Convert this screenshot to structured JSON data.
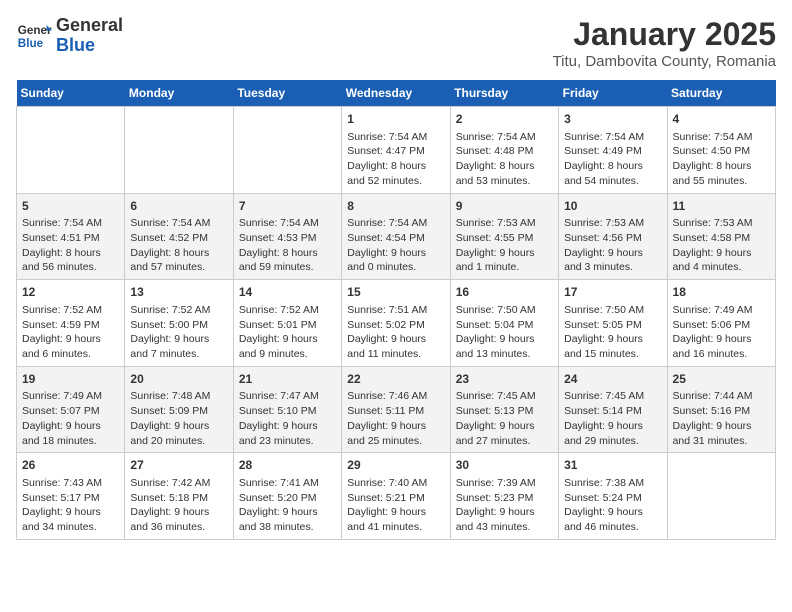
{
  "header": {
    "logo_general": "General",
    "logo_blue": "Blue",
    "title": "January 2025",
    "subtitle": "Titu, Dambovita County, Romania"
  },
  "days_of_week": [
    "Sunday",
    "Monday",
    "Tuesday",
    "Wednesday",
    "Thursday",
    "Friday",
    "Saturday"
  ],
  "weeks": [
    [
      {
        "day": "",
        "detail": ""
      },
      {
        "day": "",
        "detail": ""
      },
      {
        "day": "",
        "detail": ""
      },
      {
        "day": "1",
        "detail": "Sunrise: 7:54 AM\nSunset: 4:47 PM\nDaylight: 8 hours and 52 minutes."
      },
      {
        "day": "2",
        "detail": "Sunrise: 7:54 AM\nSunset: 4:48 PM\nDaylight: 8 hours and 53 minutes."
      },
      {
        "day": "3",
        "detail": "Sunrise: 7:54 AM\nSunset: 4:49 PM\nDaylight: 8 hours and 54 minutes."
      },
      {
        "day": "4",
        "detail": "Sunrise: 7:54 AM\nSunset: 4:50 PM\nDaylight: 8 hours and 55 minutes."
      }
    ],
    [
      {
        "day": "5",
        "detail": "Sunrise: 7:54 AM\nSunset: 4:51 PM\nDaylight: 8 hours and 56 minutes."
      },
      {
        "day": "6",
        "detail": "Sunrise: 7:54 AM\nSunset: 4:52 PM\nDaylight: 8 hours and 57 minutes."
      },
      {
        "day": "7",
        "detail": "Sunrise: 7:54 AM\nSunset: 4:53 PM\nDaylight: 8 hours and 59 minutes."
      },
      {
        "day": "8",
        "detail": "Sunrise: 7:54 AM\nSunset: 4:54 PM\nDaylight: 9 hours and 0 minutes."
      },
      {
        "day": "9",
        "detail": "Sunrise: 7:53 AM\nSunset: 4:55 PM\nDaylight: 9 hours and 1 minute."
      },
      {
        "day": "10",
        "detail": "Sunrise: 7:53 AM\nSunset: 4:56 PM\nDaylight: 9 hours and 3 minutes."
      },
      {
        "day": "11",
        "detail": "Sunrise: 7:53 AM\nSunset: 4:58 PM\nDaylight: 9 hours and 4 minutes."
      }
    ],
    [
      {
        "day": "12",
        "detail": "Sunrise: 7:52 AM\nSunset: 4:59 PM\nDaylight: 9 hours and 6 minutes."
      },
      {
        "day": "13",
        "detail": "Sunrise: 7:52 AM\nSunset: 5:00 PM\nDaylight: 9 hours and 7 minutes."
      },
      {
        "day": "14",
        "detail": "Sunrise: 7:52 AM\nSunset: 5:01 PM\nDaylight: 9 hours and 9 minutes."
      },
      {
        "day": "15",
        "detail": "Sunrise: 7:51 AM\nSunset: 5:02 PM\nDaylight: 9 hours and 11 minutes."
      },
      {
        "day": "16",
        "detail": "Sunrise: 7:50 AM\nSunset: 5:04 PM\nDaylight: 9 hours and 13 minutes."
      },
      {
        "day": "17",
        "detail": "Sunrise: 7:50 AM\nSunset: 5:05 PM\nDaylight: 9 hours and 15 minutes."
      },
      {
        "day": "18",
        "detail": "Sunrise: 7:49 AM\nSunset: 5:06 PM\nDaylight: 9 hours and 16 minutes."
      }
    ],
    [
      {
        "day": "19",
        "detail": "Sunrise: 7:49 AM\nSunset: 5:07 PM\nDaylight: 9 hours and 18 minutes."
      },
      {
        "day": "20",
        "detail": "Sunrise: 7:48 AM\nSunset: 5:09 PM\nDaylight: 9 hours and 20 minutes."
      },
      {
        "day": "21",
        "detail": "Sunrise: 7:47 AM\nSunset: 5:10 PM\nDaylight: 9 hours and 23 minutes."
      },
      {
        "day": "22",
        "detail": "Sunrise: 7:46 AM\nSunset: 5:11 PM\nDaylight: 9 hours and 25 minutes."
      },
      {
        "day": "23",
        "detail": "Sunrise: 7:45 AM\nSunset: 5:13 PM\nDaylight: 9 hours and 27 minutes."
      },
      {
        "day": "24",
        "detail": "Sunrise: 7:45 AM\nSunset: 5:14 PM\nDaylight: 9 hours and 29 minutes."
      },
      {
        "day": "25",
        "detail": "Sunrise: 7:44 AM\nSunset: 5:16 PM\nDaylight: 9 hours and 31 minutes."
      }
    ],
    [
      {
        "day": "26",
        "detail": "Sunrise: 7:43 AM\nSunset: 5:17 PM\nDaylight: 9 hours and 34 minutes."
      },
      {
        "day": "27",
        "detail": "Sunrise: 7:42 AM\nSunset: 5:18 PM\nDaylight: 9 hours and 36 minutes."
      },
      {
        "day": "28",
        "detail": "Sunrise: 7:41 AM\nSunset: 5:20 PM\nDaylight: 9 hours and 38 minutes."
      },
      {
        "day": "29",
        "detail": "Sunrise: 7:40 AM\nSunset: 5:21 PM\nDaylight: 9 hours and 41 minutes."
      },
      {
        "day": "30",
        "detail": "Sunrise: 7:39 AM\nSunset: 5:23 PM\nDaylight: 9 hours and 43 minutes."
      },
      {
        "day": "31",
        "detail": "Sunrise: 7:38 AM\nSunset: 5:24 PM\nDaylight: 9 hours and 46 minutes."
      },
      {
        "day": "",
        "detail": ""
      }
    ]
  ]
}
